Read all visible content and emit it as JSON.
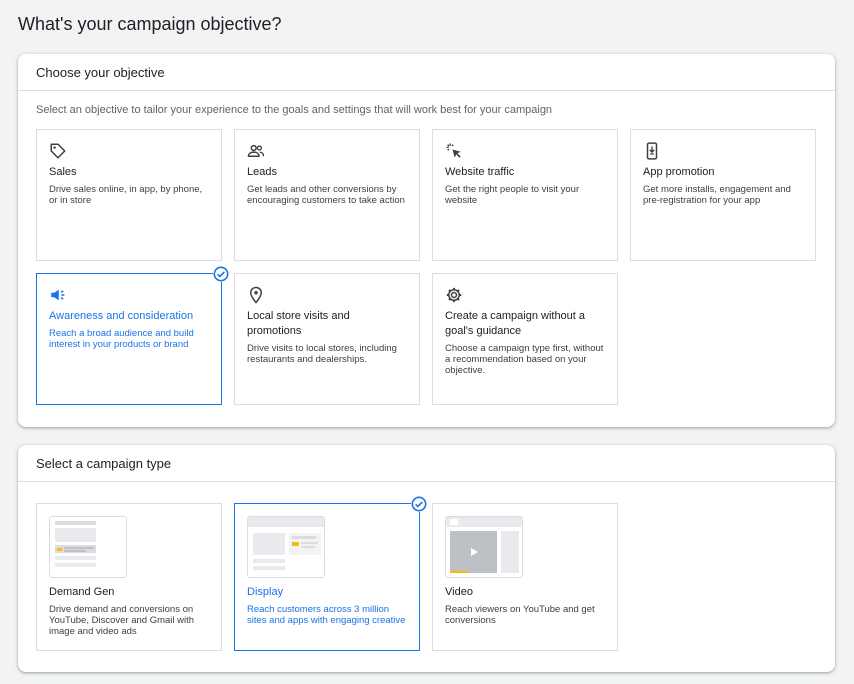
{
  "page_title": "What's your campaign objective?",
  "objective_panel": {
    "header": "Choose your objective",
    "description": "Select an objective to tailor your experience to the goals and settings that will work best for your campaign",
    "cards": [
      {
        "title": "Sales",
        "desc": "Drive sales online, in app, by phone, or in store",
        "icon": "tag-icon",
        "selected": false
      },
      {
        "title": "Leads",
        "desc": "Get leads and other conversions by encouraging customers to take action",
        "icon": "people-icon",
        "selected": false
      },
      {
        "title": "Website traffic",
        "desc": "Get the right people to visit your website",
        "icon": "cursor-click-icon",
        "selected": false
      },
      {
        "title": "App promotion",
        "desc": "Get more installs, engagement and pre-registration for your app",
        "icon": "phone-download-icon",
        "selected": false
      },
      {
        "title": "Awareness and consideration",
        "desc": "Reach a broad audience and build interest in your products or brand",
        "icon": "megaphone-icon",
        "selected": true
      },
      {
        "title": "Local store visits and promotions",
        "desc": "Drive visits to local stores, including restaurants and dealerships.",
        "icon": "location-pin-icon",
        "selected": false
      },
      {
        "title": "Create a campaign without a goal's guidance",
        "desc": "Choose a campaign type first, without a recommendation based on your objective.",
        "icon": "gear-icon",
        "selected": false
      }
    ]
  },
  "type_panel": {
    "header": "Select a campaign type",
    "cards": [
      {
        "title": "Demand Gen",
        "desc": "Drive demand and conversions on YouTube, Discover and Gmail with image and video ads",
        "selected": false
      },
      {
        "title": "Display",
        "desc": "Reach customers across 3 million sites and apps with engaging creative",
        "selected": true
      },
      {
        "title": "Video",
        "desc": "Reach viewers on YouTube and get conversions",
        "selected": false
      }
    ]
  },
  "colors": {
    "accent": "#1a73e8",
    "border": "#dadce0",
    "icon": "#5f6368",
    "thumb_yellow": "#fbbc04"
  }
}
